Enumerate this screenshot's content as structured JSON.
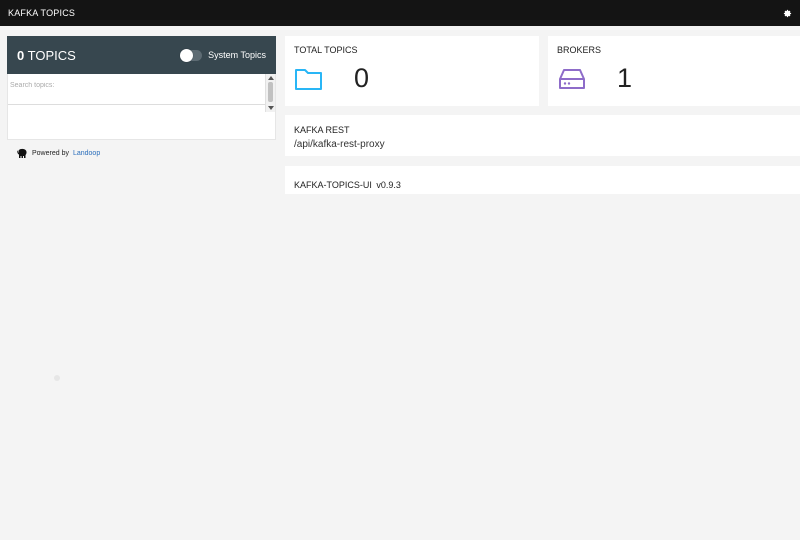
{
  "app": {
    "title": "KAFKA TOPICS"
  },
  "header": {
    "settings_icon": "gear-icon"
  },
  "topics_panel": {
    "count": "0",
    "label": "TOPICS",
    "system_topics_label": "System Topics",
    "system_topics_enabled": false,
    "search_placeholder": "Search topics:"
  },
  "powered_by": {
    "prefix": "Powered by",
    "link": "Landoop"
  },
  "cards": {
    "total_topics": {
      "title": "TOTAL TOPICS",
      "value": "0",
      "icon": "folder-icon",
      "color": "#29b6f6"
    },
    "brokers": {
      "title": "BROKERS",
      "value": "1",
      "icon": "server-icon",
      "color": "#8e6cc9"
    },
    "kafka_rest": {
      "title": "KAFKA REST",
      "value": "/api/kafka-rest-proxy"
    },
    "version": {
      "name": "KAFKA-TOPICS-UI",
      "value": "v0.9.3"
    }
  }
}
